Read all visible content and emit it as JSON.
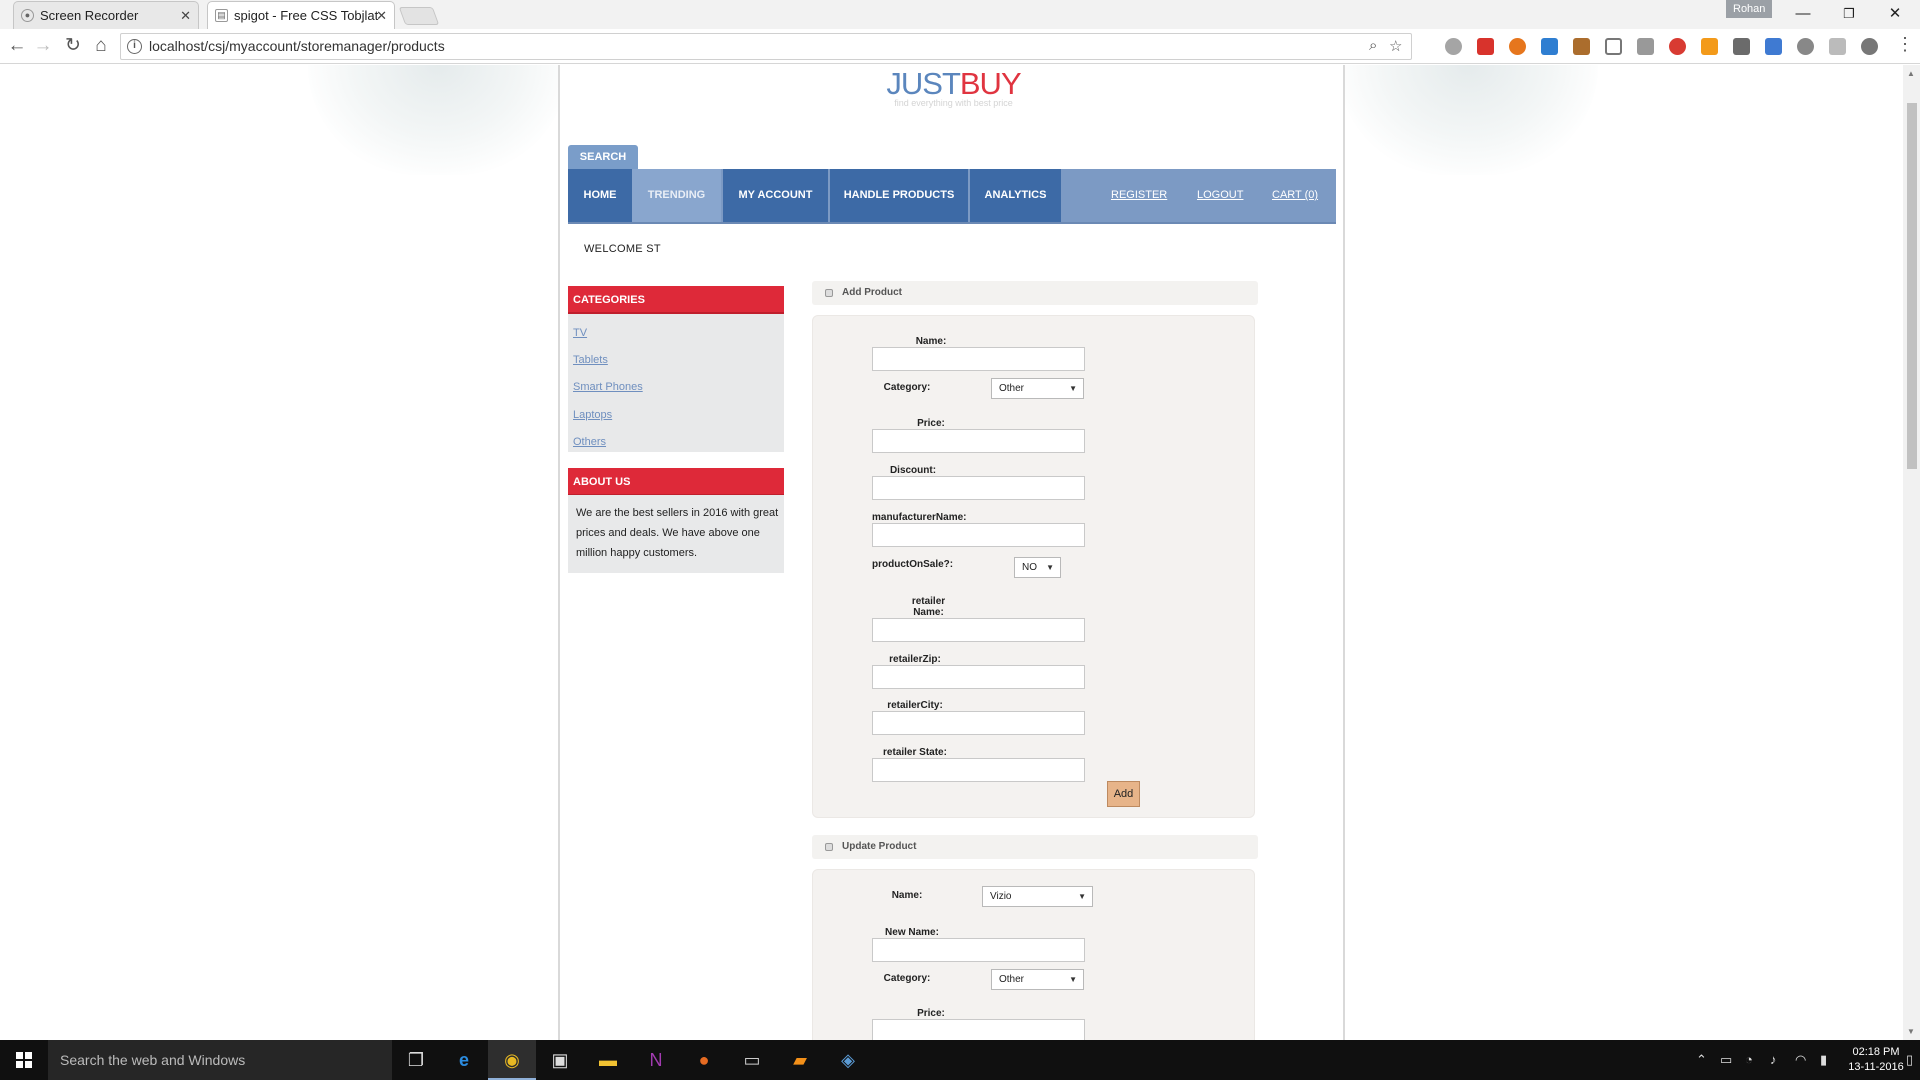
{
  "browser": {
    "tabs": [
      {
        "title": "Screen Recorder",
        "active": false
      },
      {
        "title": "spigot - Free CSS Tobjlat",
        "active": true
      }
    ],
    "user": "Rohan",
    "url": "localhost/csj/myaccount/storemanager/products"
  },
  "site": {
    "logo_part1": "JUST",
    "logo_part2": "BUY",
    "tagline": "find everything with best price",
    "search_tab": "SEARCH",
    "nav": {
      "home": "HOME",
      "trending": "TRENDING",
      "my_account": "MY ACCOUNT",
      "handle_products": "HANDLE PRODUCTS",
      "analytics": "ANALYTICS",
      "register": "REGISTER",
      "logout": "LOGOUT",
      "cart": "CART (0)"
    },
    "welcome": "WELCOME ST",
    "sidebar": {
      "categories_title": "CATEGORIES",
      "categories": [
        "TV",
        "Tablets",
        "Smart Phones",
        "Laptops",
        "Others"
      ],
      "about_title": "ABOUT US",
      "about_text": "We are the best sellers in 2016 with great prices and deals. We have above one million happy customers."
    },
    "add_product": {
      "title": "Add Product",
      "name_label": "Name:",
      "category_label": "Category:",
      "category_value": "Other",
      "price_label": "Price:",
      "discount_label": "Discount:",
      "manufacturer_label": "manufacturerName:",
      "on_sale_label": "productOnSale?:",
      "on_sale_value": "NO",
      "retailer_name_label": "retailer Name:",
      "retailer_zip_label": "retailerZip:",
      "retailer_city_label": "retailerCity:",
      "retailer_state_label": "retailer State:",
      "submit": "Add"
    },
    "update_product": {
      "title": "Update Product",
      "name_label": "Name:",
      "name_value": "Vizio",
      "new_name_label": "New Name:",
      "category_label": "Category:",
      "category_value": "Other",
      "price_label": "Price:"
    }
  },
  "taskbar": {
    "search_placeholder": "Search the web and Windows",
    "time": "02:18 PM",
    "date": "13-11-2016"
  }
}
